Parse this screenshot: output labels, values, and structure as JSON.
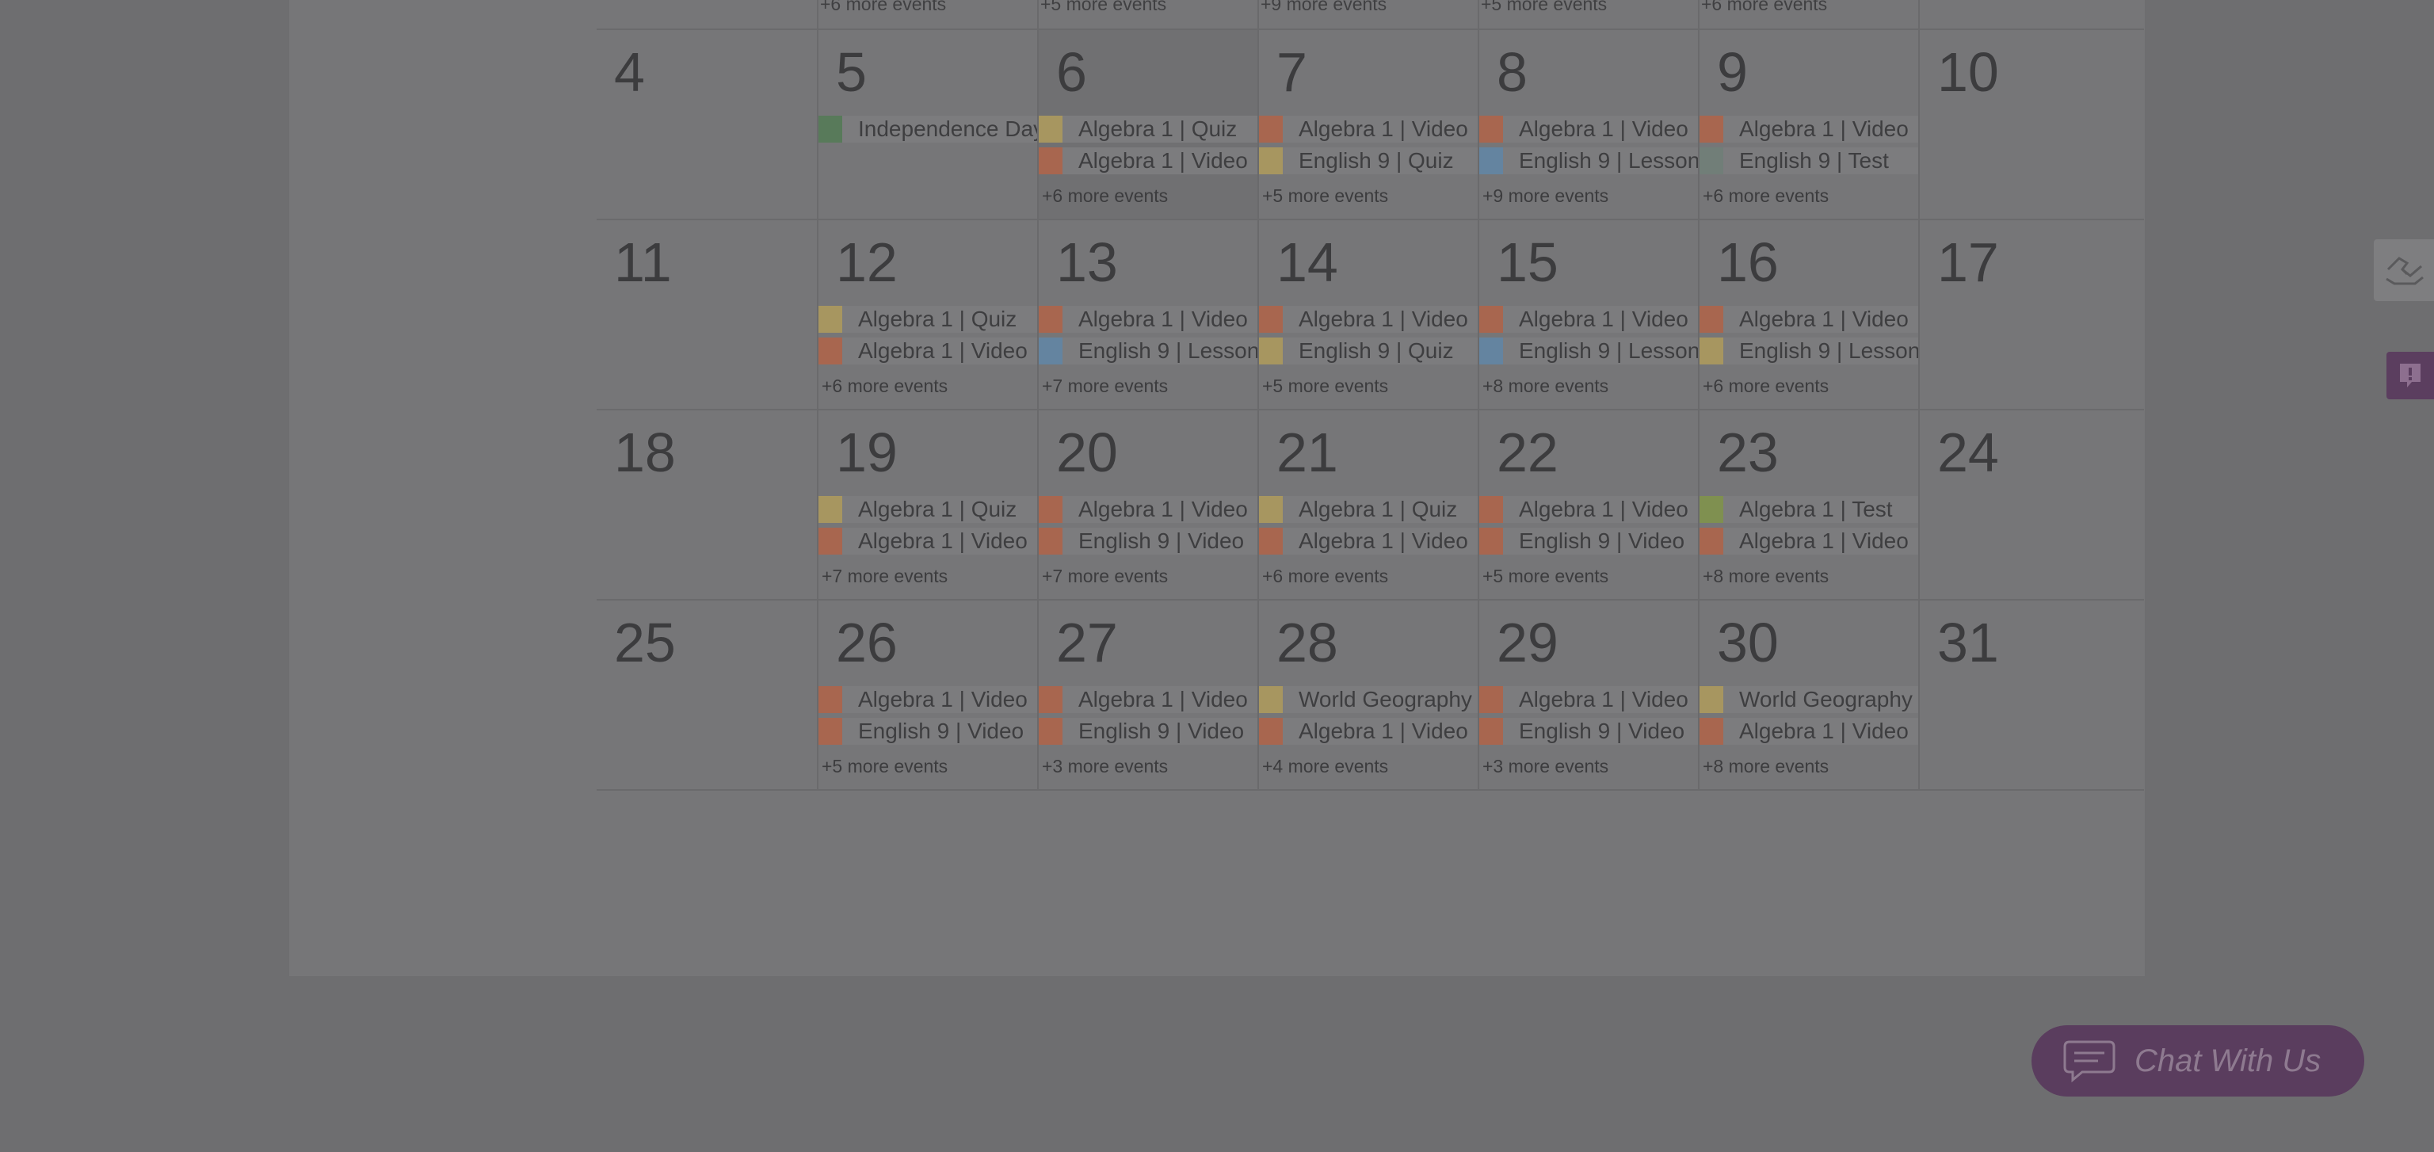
{
  "colors": {
    "video": "#a8664f",
    "quiz": "#a79660",
    "holiday": "#587a5a",
    "lesson": "#6484a0",
    "test_english": "#717e78",
    "test_algebra": "#7f9050"
  },
  "prev_week_more": [
    "+6 more events",
    "+5 more events",
    "+9 more events",
    "+5 more events",
    "+6 more events"
  ],
  "weeks": [
    {
      "days": [
        {
          "num": "4",
          "events": [],
          "more": ""
        },
        {
          "num": "5",
          "events": [
            {
              "label": "Independence Day",
              "color": "#587a5a"
            }
          ],
          "more": ""
        },
        {
          "num": "6",
          "today": true,
          "events": [
            {
              "label": "Algebra 1 | Quiz",
              "color": "#a79660"
            },
            {
              "label": "Algebra 1 | Video",
              "color": "#a8664f"
            }
          ],
          "more": "+6 more events"
        },
        {
          "num": "7",
          "events": [
            {
              "label": "Algebra 1 | Video",
              "color": "#a8664f"
            },
            {
              "label": "English 9 | Quiz",
              "color": "#a79660"
            }
          ],
          "more": "+5 more events"
        },
        {
          "num": "8",
          "events": [
            {
              "label": "Algebra 1 | Video",
              "color": "#a8664f"
            },
            {
              "label": "English 9 | Lesson",
              "color": "#6484a0"
            }
          ],
          "more": "+9 more events"
        },
        {
          "num": "9",
          "events": [
            {
              "label": "Algebra 1 | Video",
              "color": "#a8664f"
            },
            {
              "label": "English 9 | Test",
              "color": "#717e78"
            }
          ],
          "more": "+6 more events"
        },
        {
          "num": "10",
          "events": [],
          "more": ""
        }
      ]
    },
    {
      "days": [
        {
          "num": "11",
          "events": [],
          "more": ""
        },
        {
          "num": "12",
          "events": [
            {
              "label": "Algebra 1 | Quiz",
              "color": "#a79660"
            },
            {
              "label": "Algebra 1 | Video",
              "color": "#a8664f"
            }
          ],
          "more": "+6 more events"
        },
        {
          "num": "13",
          "events": [
            {
              "label": "Algebra 1 | Video",
              "color": "#a8664f"
            },
            {
              "label": "English 9 | Lesson",
              "color": "#6484a0"
            }
          ],
          "more": "+7 more events"
        },
        {
          "num": "14",
          "events": [
            {
              "label": "Algebra 1 | Video",
              "color": "#a8664f"
            },
            {
              "label": "English 9 | Quiz",
              "color": "#a79660"
            }
          ],
          "more": "+5 more events"
        },
        {
          "num": "15",
          "events": [
            {
              "label": "Algebra 1 | Video",
              "color": "#a8664f"
            },
            {
              "label": "English 9 | Lesson",
              "color": "#6484a0"
            }
          ],
          "more": "+8 more events"
        },
        {
          "num": "16",
          "events": [
            {
              "label": "Algebra 1 | Video",
              "color": "#a8664f"
            },
            {
              "label": "English 9 | Lesson",
              "color": "#a79660"
            }
          ],
          "more": "+6 more events"
        },
        {
          "num": "17",
          "events": [],
          "more": ""
        }
      ]
    },
    {
      "days": [
        {
          "num": "18",
          "events": [],
          "more": ""
        },
        {
          "num": "19",
          "events": [
            {
              "label": "Algebra 1 | Quiz",
              "color": "#a79660"
            },
            {
              "label": "Algebra 1 | Video",
              "color": "#a8664f"
            }
          ],
          "more": "+7 more events"
        },
        {
          "num": "20",
          "events": [
            {
              "label": "Algebra 1 | Video",
              "color": "#a8664f"
            },
            {
              "label": "English 9 | Video",
              "color": "#a8664f"
            }
          ],
          "more": "+7 more events"
        },
        {
          "num": "21",
          "events": [
            {
              "label": "Algebra 1 | Quiz",
              "color": "#a79660"
            },
            {
              "label": "Algebra 1 | Video",
              "color": "#a8664f"
            }
          ],
          "more": "+6 more events"
        },
        {
          "num": "22",
          "events": [
            {
              "label": "Algebra 1 | Video",
              "color": "#a8664f"
            },
            {
              "label": "English 9 | Video",
              "color": "#a8664f"
            }
          ],
          "more": "+5 more events"
        },
        {
          "num": "23",
          "events": [
            {
              "label": "Algebra 1 | Test",
              "color": "#7f9050"
            },
            {
              "label": "Algebra 1 | Video",
              "color": "#a8664f"
            }
          ],
          "more": "+8 more events"
        },
        {
          "num": "24",
          "events": [],
          "more": ""
        }
      ]
    },
    {
      "days": [
        {
          "num": "25",
          "events": [],
          "more": ""
        },
        {
          "num": "26",
          "events": [
            {
              "label": "Algebra 1 | Video",
              "color": "#a8664f"
            },
            {
              "label": "English 9 | Video",
              "color": "#a8664f"
            }
          ],
          "more": "+5 more events"
        },
        {
          "num": "27",
          "events": [
            {
              "label": "Algebra 1 | Video",
              "color": "#a8664f"
            },
            {
              "label": "English 9 | Video",
              "color": "#a8664f"
            }
          ],
          "more": "+3 more events"
        },
        {
          "num": "28",
          "events": [
            {
              "label": "World Geography",
              "color": "#a79660"
            },
            {
              "label": "Algebra 1 | Video",
              "color": "#a8664f"
            }
          ],
          "more": "+4 more events"
        },
        {
          "num": "29",
          "events": [
            {
              "label": "Algebra 1 | Video",
              "color": "#a8664f"
            },
            {
              "label": "English 9 | Video",
              "color": "#a8664f"
            }
          ],
          "more": "+3 more events"
        },
        {
          "num": "30",
          "events": [
            {
              "label": "World Geography",
              "color": "#a79660"
            },
            {
              "label": "Algebra 1 | Video",
              "color": "#a8664f"
            }
          ],
          "more": "+8 more events"
        },
        {
          "num": "31",
          "events": [],
          "more": ""
        }
      ]
    }
  ],
  "side": {
    "first_icon": "hand-heart-icon",
    "second_icon": "feedback-icon"
  },
  "chat": {
    "label": "Chat With Us",
    "icon": "chat-bubble-icon"
  }
}
